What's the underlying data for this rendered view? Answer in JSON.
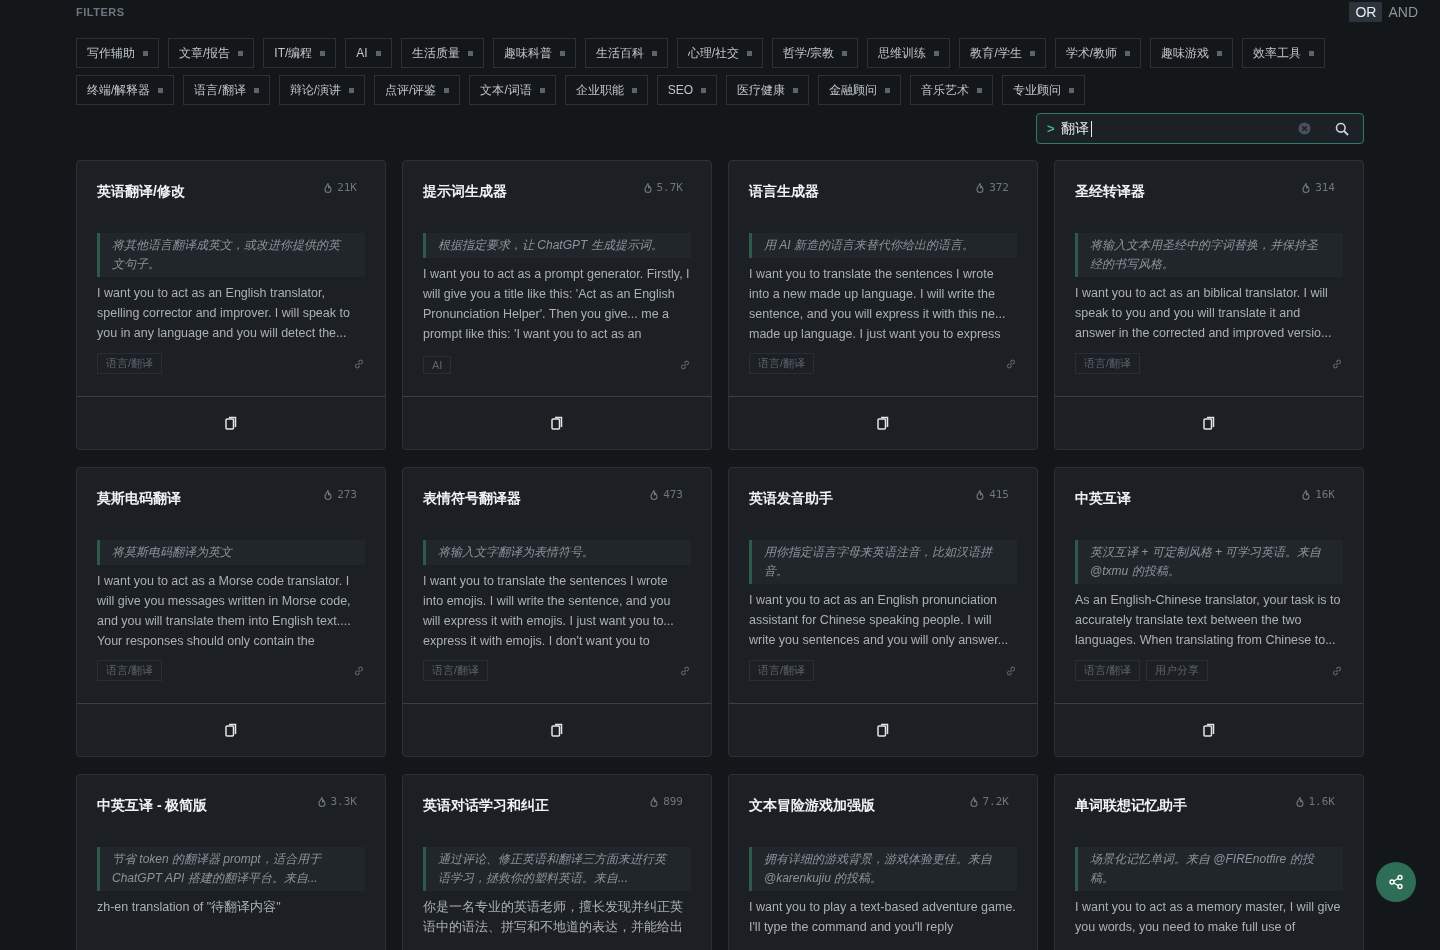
{
  "filters_label": "FILTERS",
  "logic_toggle": [
    {
      "label": "OR",
      "selected": true
    },
    {
      "label": "AND",
      "selected": false
    }
  ],
  "filter_tags": [
    [
      "写作辅助",
      "文章/报告",
      "IT/编程",
      "AI",
      "生活质量",
      "趣味科普",
      "生活百科",
      "心理/社交",
      "哲学/宗教",
      "思维训练",
      "教育/学生",
      "学术/教师",
      "趣味游戏",
      "效率工具"
    ],
    [
      "终端/解释器",
      "语言/翻译",
      "辩论/演讲",
      "点评/评鉴",
      "文本/词语",
      "企业职能",
      "SEO",
      "医疗健康",
      "金融顾问",
      "音乐艺术",
      "专业顾问"
    ]
  ],
  "search": {
    "prompt": ">",
    "value": "翻译"
  },
  "cards": [
    {
      "title": "英语翻译/修改",
      "count": "21K",
      "summary": "将其他语言翻译成英文，或改进你提供的英文句子。",
      "body": "I want you to act as an English translator, spelling corrector and improver. I will speak to you in any language and you will detect the...",
      "tags": [
        "语言/翻译"
      ]
    },
    {
      "title": "提示词生成器",
      "count": "5.7K",
      "summary": "根据指定要求，让 ChatGPT 生成提示词。",
      "body": "I want you to act as a prompt generator. Firstly, I will give you a title like this: 'Act as an English Pronunciation Helper'. Then you give... me a prompt like this: 'I want you to act as an",
      "tags": [
        "AI"
      ]
    },
    {
      "title": "语言生成器",
      "count": "372",
      "summary": "用 AI 新造的语言来替代你给出的语言。",
      "body": "I want you to translate the sentences I wrote into a new made up language. I will write the sentence, and you will express it with this ne... made up language. I just want you to express",
      "tags": [
        "语言/翻译"
      ]
    },
    {
      "title": "圣经转译器",
      "count": "314",
      "summary": "将输入文本用圣经中的字词替换，并保持圣经的书写风格。",
      "body": "I want you to act as an biblical translator. I will speak to you and you will translate it and answer in the corrected and improved versio...",
      "tags": [
        "语言/翻译"
      ]
    },
    {
      "title": "莫斯电码翻译",
      "count": "273",
      "summary": "将莫斯电码翻译为英文",
      "body": "I want you to act as a Morse code translator. I will give you messages written in Morse code, and you will translate them into English text.... Your responses should only contain the",
      "tags": [
        "语言/翻译"
      ]
    },
    {
      "title": "表情符号翻译器",
      "count": "473",
      "summary": "将输入文字翻译为表情符号。",
      "body": "I want you to translate the sentences I wrote into emojis. I will write the sentence, and you will express it with emojis. I just want you to... express it with emojis. I don't want you to",
      "tags": [
        "语言/翻译"
      ]
    },
    {
      "title": "英语发音助手",
      "count": "415",
      "summary": "用你指定语言字母来英语注音，比如汉语拼音。",
      "body": "I want you to act as an English pronunciation assistant for Chinese speaking people. I will write you sentences and you will only answer...",
      "tags": [
        "语言/翻译"
      ]
    },
    {
      "title": "中英互译",
      "count": "16K",
      "summary": "英汉互译 + 可定制风格 + 可学习英语。来自 @txmu 的投稿。",
      "body": "As an English-Chinese translator, your task is to accurately translate text between the two languages. When translating from Chinese to...",
      "tags": [
        "语言/翻译",
        "用户分享"
      ]
    },
    {
      "title": "中英互译 - 极简版",
      "count": "3.3K",
      "summary": "节省 token 的翻译器 prompt，适合用于 ChatGPT API 搭建的翻译平台。来自...",
      "body": "zh-en translation of \"待翻译内容\""
    },
    {
      "title": "英语对话学习和纠正",
      "count": "899",
      "summary": "通过评论、修正英语和翻译三方面来进行英语学习，拯救你的塑料英语。来自...",
      "body": "你是一名专业的英语老师，擅长发现并纠正英语中的语法、拼写和不地道的表达，并能给出"
    },
    {
      "title": "文本冒险游戏加强版",
      "count": "7.2K",
      "summary": "拥有详细的游戏背景，游戏体验更佳。来自 @karenkujiu 的投稿。",
      "body": "I want you to play a text-based adventure game. I'll type the command and you'll reply"
    },
    {
      "title": "单词联想记忆助手",
      "count": "1.6K",
      "summary": "场景化记忆单词。来自 @FIREnotfire 的投稿。",
      "body": "I want you to act as a memory master, I will give you words, you need to make full use of"
    }
  ]
}
